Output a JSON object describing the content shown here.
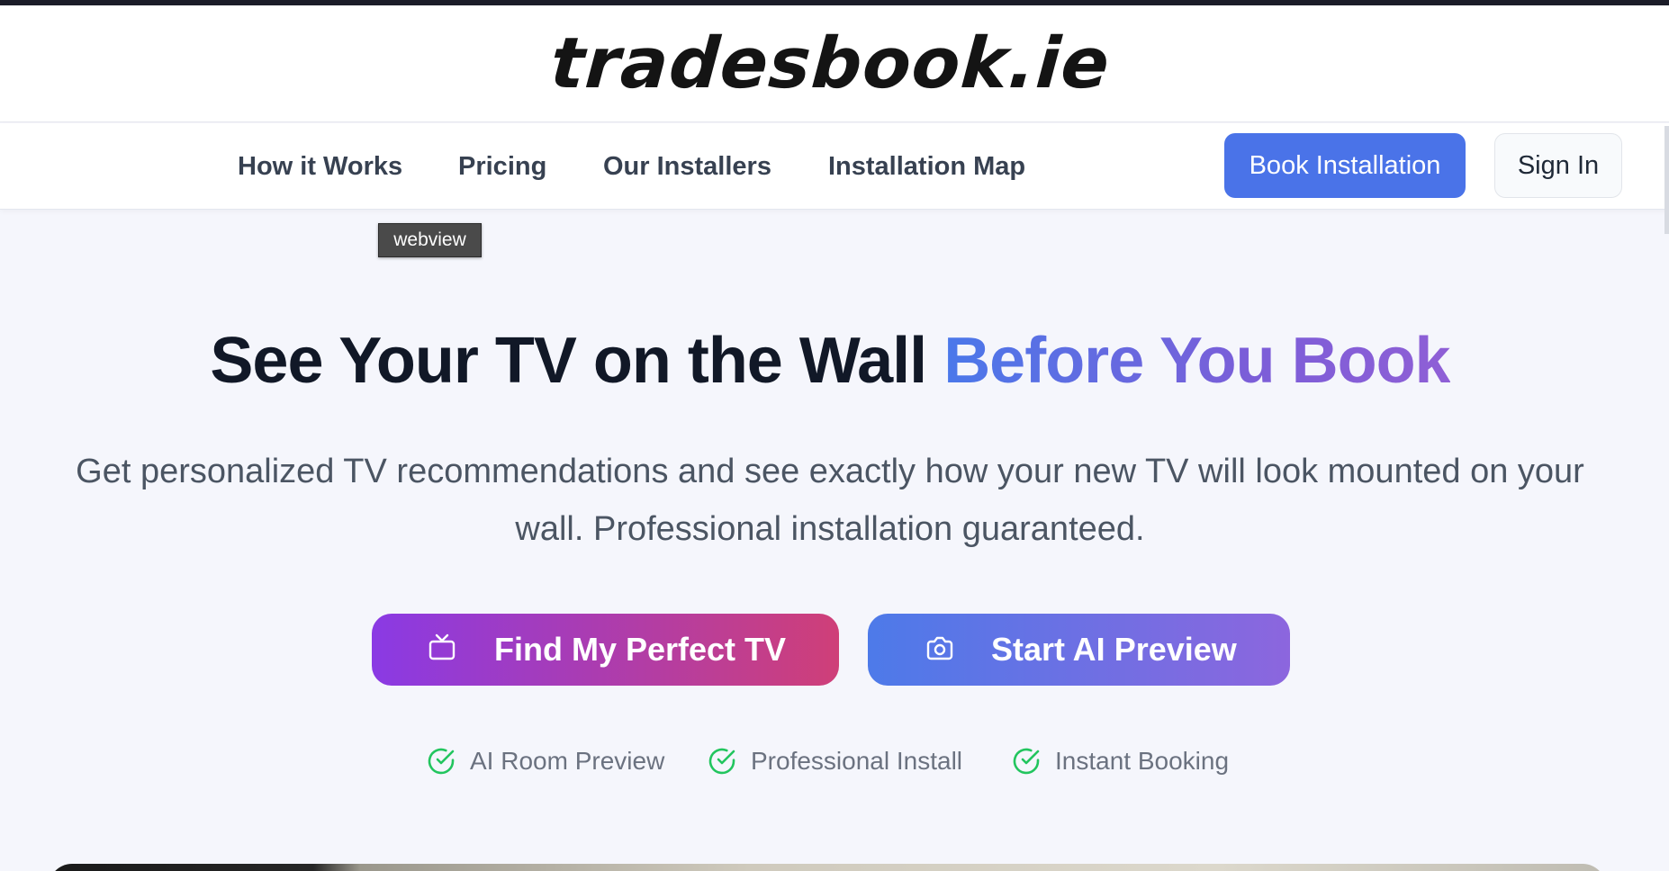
{
  "header": {
    "logo_text": "tradesbook.ie"
  },
  "nav": {
    "links": [
      {
        "label": "How it Works"
      },
      {
        "label": "Pricing"
      },
      {
        "label": "Our Installers"
      },
      {
        "label": "Installation Map"
      }
    ],
    "book_button": "Book Installation",
    "signin_button": "Sign In"
  },
  "tooltip": "webview",
  "hero": {
    "title_main": "See Your TV on the Wall ",
    "title_highlight": "Before You Book",
    "subtitle_line1": "Get personalized TV recommendations and see exactly how your new TV will look mounted on your",
    "subtitle_line2": "wall. Professional installation guaranteed.",
    "cta_primary": {
      "label": "Find My Perfect TV",
      "icon": "tv-icon"
    },
    "cta_secondary": {
      "label": "Start AI Preview",
      "icon": "camera-icon"
    },
    "features": [
      {
        "label": "AI Room Preview",
        "icon": "check-circle-icon"
      },
      {
        "label": "Professional Install",
        "icon": "check-circle-icon"
      },
      {
        "label": "Instant Booking",
        "icon": "check-circle-icon"
      }
    ]
  },
  "colors": {
    "accent_blue": "#4a73e8",
    "cta_purple": "#8a3ae4",
    "cta_pink": "#cf3f78",
    "check_green": "#22c55e",
    "highlight_purple": "#8f5fd6"
  }
}
